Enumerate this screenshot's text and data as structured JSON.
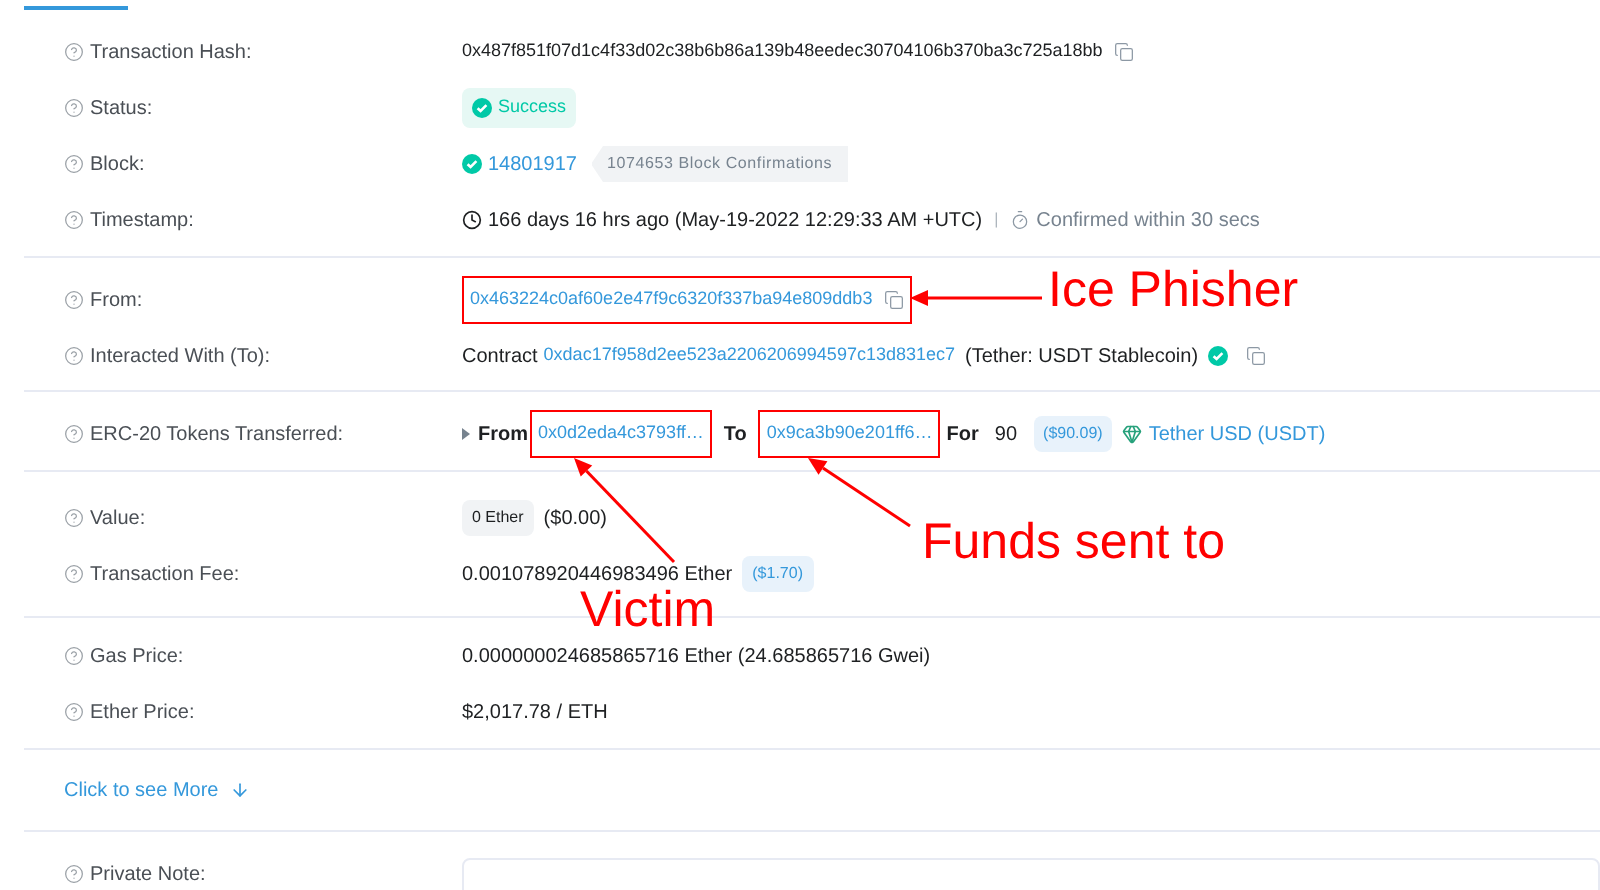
{
  "sections": [
    {
      "rows": [
        {
          "kind": "hash",
          "label": "Transaction Hash:",
          "value": "0x487f851f07d1c4f33d02c38b6b86a139b48eedec30704106b370ba3c725a18bb"
        },
        {
          "kind": "status",
          "label": "Status:",
          "value": "Success"
        },
        {
          "kind": "block",
          "label": "Block:",
          "value": "14801917",
          "confirmations": "1074653 Block Confirmations"
        },
        {
          "kind": "timestamp",
          "label": "Timestamp:",
          "value": "166 days 16 hrs ago (May-19-2022 12:29:33 AM +UTC)",
          "separator": "|",
          "confirmed": "Confirmed within 30 secs"
        }
      ]
    },
    {
      "rows": [
        {
          "kind": "address",
          "label": "From:",
          "value": "0x463224c0af60e2e47f9c6320f337ba94e809ddb3",
          "highlighted": true
        },
        {
          "kind": "contract",
          "label": "Interacted With (To):",
          "prefix": "Contract",
          "value": "0xdac17f958d2ee523a2206206994597c13d831ec7",
          "name": "(Tether: USDT Stablecoin)",
          "verified": true
        }
      ]
    },
    {
      "rows": [
        {
          "kind": "transfer",
          "label": "ERC-20 Tokens Transferred:",
          "from_word": "From",
          "from": {
            "value": "0x0d2eda4c3793ff…",
            "highlighted": true
          },
          "to_word": "To",
          "to": {
            "value": "0x9ca3b90e201ff6…",
            "highlighted": true
          },
          "for_word": "For",
          "amount": "90",
          "usd": "($90.09)",
          "token": "Tether USD (USDT)"
        }
      ]
    },
    {
      "rows": [
        {
          "kind": "value",
          "label": "Value:",
          "badge": "0 Ether",
          "value": "($0.00)"
        },
        {
          "kind": "fee",
          "label": "Transaction Fee:",
          "value": "0.001078920446983496 Ether",
          "usd": "($1.70)"
        }
      ]
    },
    {
      "rows": [
        {
          "kind": "text",
          "label": "Gas Price:",
          "value": "0.000000024685865716 Ether (24.685865716 Gwei)"
        },
        {
          "kind": "text",
          "label": "Ether Price:",
          "value": "$2,017.78 / ETH"
        }
      ]
    },
    {
      "rows": [
        {
          "kind": "more",
          "label": "Click to see More"
        }
      ]
    },
    {
      "rows": [
        {
          "kind": "note",
          "label": "Private Note:"
        }
      ]
    }
  ],
  "annotations": [
    {
      "text": "Ice Phisher"
    },
    {
      "text": "Funds sent to"
    },
    {
      "text": "Victim"
    }
  ]
}
